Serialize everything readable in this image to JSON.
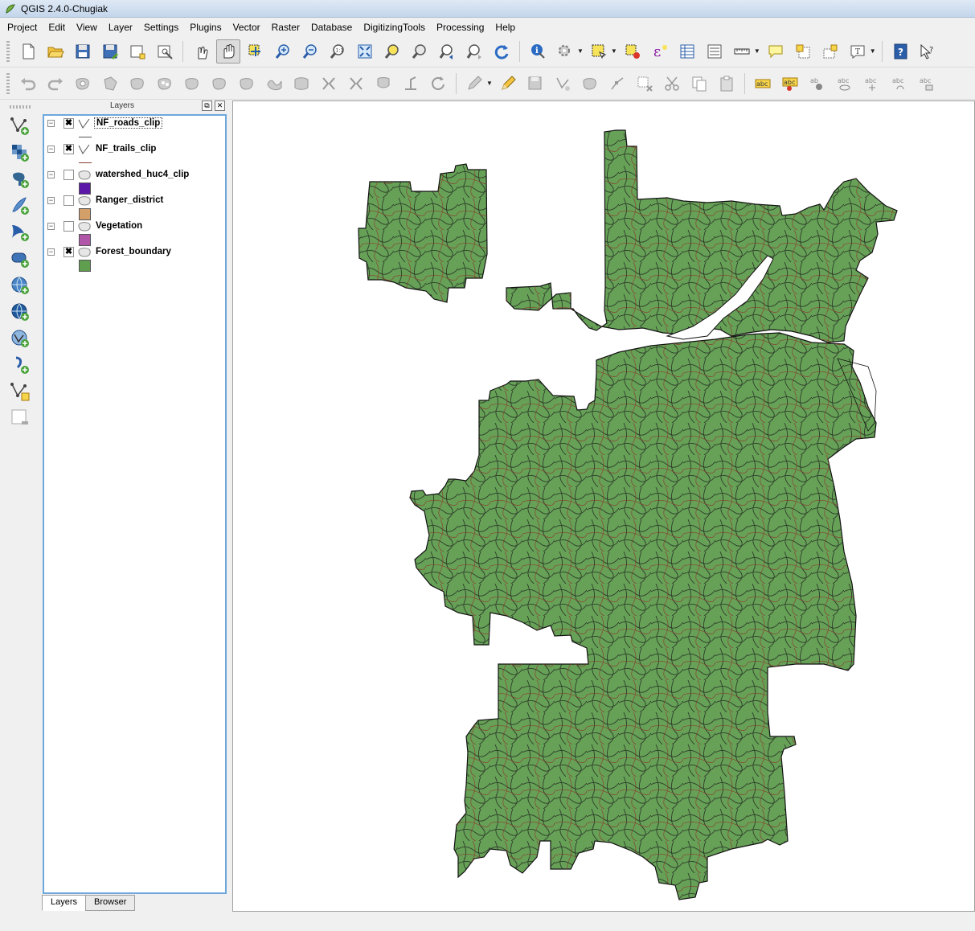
{
  "window": {
    "title": "QGIS 2.4.0-Chugiak",
    "app_icon": "qgis-logo-icon"
  },
  "menu": [
    "Project",
    "Edit",
    "View",
    "Layer",
    "Settings",
    "Plugins",
    "Vector",
    "Raster",
    "Database",
    "DigitizingTools",
    "Processing",
    "Help"
  ],
  "layers_panel": {
    "title": "Layers",
    "float_icon": "float-panel-icon",
    "close_icon": "close-icon",
    "layers": [
      {
        "name": "NF_roads_clip",
        "checked": true,
        "kind": "line",
        "color": "#444444",
        "current": true
      },
      {
        "name": "NF_trails_clip",
        "checked": true,
        "kind": "line",
        "color": "#8b3a2a",
        "current": false
      },
      {
        "name": "watershed_huc4_clip",
        "checked": false,
        "kind": "polygon",
        "color": "#5b17a8",
        "current": false
      },
      {
        "name": "Ranger_district",
        "checked": false,
        "kind": "polygon",
        "color": "#d4a06a",
        "current": false
      },
      {
        "name": "Vegetation",
        "checked": false,
        "kind": "polygon",
        "color": "#b055a8",
        "current": false
      },
      {
        "name": "Forest_boundary",
        "checked": true,
        "kind": "polygon",
        "color": "#5f9d4f",
        "current": false
      }
    ],
    "tabs": [
      "Layers",
      "Browser"
    ],
    "active_tab": "Layers"
  },
  "map": {
    "fill_color": "#66a157",
    "outline_color": "#111111",
    "trail_color": "#8b3a2a",
    "road_color": "#1a1a1a"
  },
  "colors": {
    "selection_border": "#6ea7dc",
    "canvas_bg": "#ffffff"
  }
}
